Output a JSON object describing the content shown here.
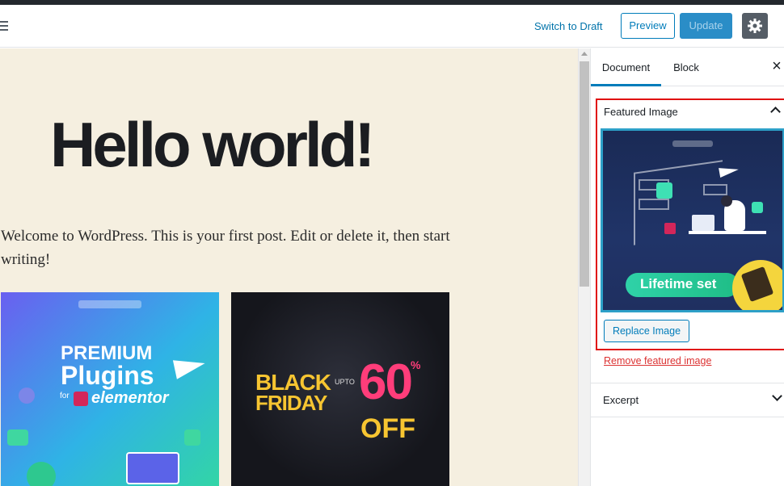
{
  "toolbar": {
    "menu_icon": "menu-icon",
    "switch_to_draft": "Switch to Draft",
    "preview": "Preview",
    "update": "Update",
    "settings_icon": "gear-icon"
  },
  "post": {
    "title": "Hello world!",
    "paragraph": "Welcome to WordPress. This is your first post. Edit or delete it, then start writing!"
  },
  "gallery": {
    "image1": {
      "line1": "PREMIUM",
      "line2": "Plugins",
      "for": "for",
      "brand": "elementor"
    },
    "image2": {
      "line1": "BLACK",
      "line2": "FRIDAY",
      "upto": "UPTO",
      "discount": "60",
      "percent": "%",
      "off": "OFF"
    }
  },
  "sidebar": {
    "tabs": [
      {
        "label": "Document",
        "active": true
      },
      {
        "label": "Block",
        "active": false
      }
    ],
    "close_icon": "close-icon",
    "featured_image": {
      "heading": "Featured Image",
      "image_banner": "Lifetime set",
      "replace_label": "Replace Image",
      "remove_label": "Remove featured image"
    },
    "excerpt": {
      "heading": "Excerpt"
    }
  },
  "colors": {
    "accent": "#007cba",
    "highlight_border": "#e01010",
    "canvas_bg": "#f5efe0",
    "remove_link": "#dc3232"
  }
}
